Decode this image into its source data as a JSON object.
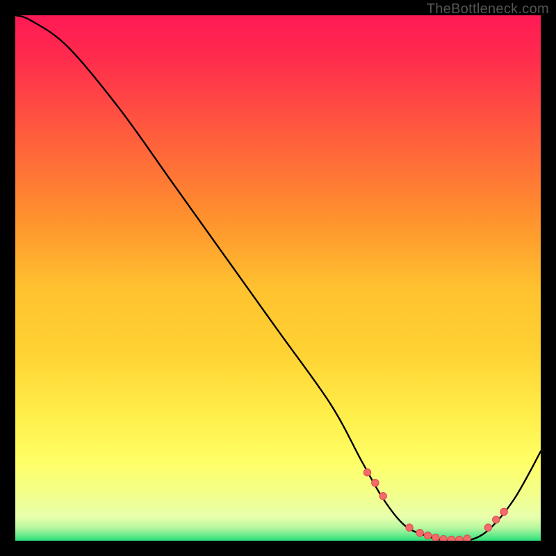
{
  "watermark": "TheBottleneck.com",
  "colors": {
    "page_bg": "#000000",
    "curve": "#000000",
    "marker_fill": "#f46a6a",
    "marker_stroke": "#d94a4a",
    "grad_top": "#ff1a55",
    "grad_mid1": "#ff6a3a",
    "grad_mid2": "#ffd233",
    "grad_mid3": "#ffff66",
    "grad_mid4": "#e8ffad",
    "grad_bottom": "#29e07a"
  },
  "chart_data": {
    "type": "line",
    "title": "",
    "xlabel": "",
    "ylabel": "",
    "xlim": [
      0,
      100
    ],
    "ylim": [
      0,
      100
    ],
    "series": [
      {
        "name": "bottleneck-curve",
        "x": [
          0,
          3,
          10,
          20,
          30,
          40,
          50,
          60,
          66,
          70,
          74,
          78,
          82,
          86,
          90,
          95,
          100
        ],
        "y": [
          100,
          99,
          94,
          82,
          68,
          54,
          40,
          26,
          15,
          8,
          3,
          1,
          0,
          0,
          2,
          8,
          17
        ]
      }
    ],
    "markers": {
      "name": "highlight-points",
      "x": [
        67,
        68.5,
        70,
        75,
        77,
        78.5,
        80,
        81.5,
        83,
        84.5,
        86,
        90,
        91.5,
        93
      ],
      "y": [
        13,
        11,
        8.5,
        2.5,
        1.5,
        1,
        0.6,
        0.3,
        0.2,
        0.2,
        0.4,
        2.5,
        4,
        5.5
      ]
    }
  }
}
